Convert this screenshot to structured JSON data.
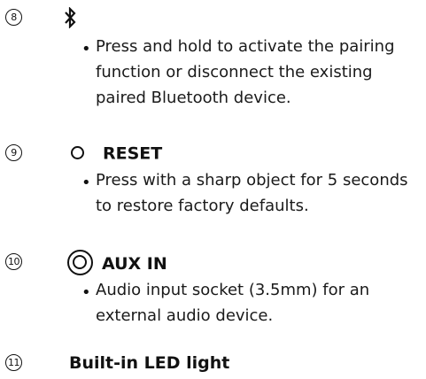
{
  "sections": [
    {
      "number": "8",
      "icon": "bluetooth-icon",
      "heading": "",
      "text": "Press and hold to activate the pairing function or disconnect the existing paired Bluetooth device."
    },
    {
      "number": "9",
      "icon": "reset-hole-icon",
      "heading": "RESET",
      "text": "Press with a sharp object for 5 seconds to restore factory defaults."
    },
    {
      "number": "10",
      "icon": "aux-socket-icon",
      "heading": "AUX IN",
      "text": "Audio input socket (3.5mm) for an external audio device."
    },
    {
      "number": "11",
      "icon": "",
      "heading": "Built-in LED light",
      "text": ""
    }
  ]
}
